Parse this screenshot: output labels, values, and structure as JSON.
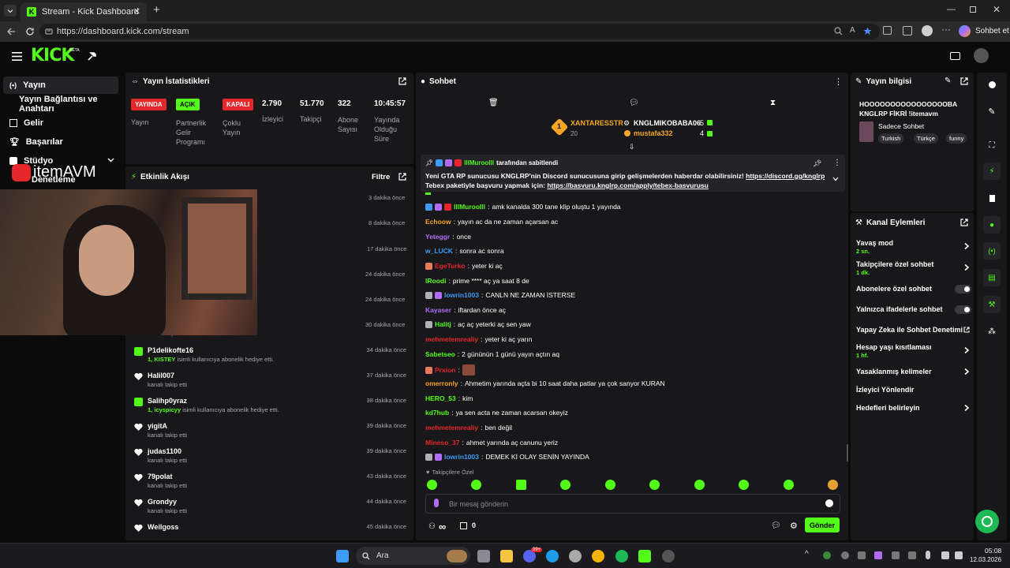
{
  "browser": {
    "tab_title": "Stream - Kick Dashboard",
    "url": "https://dashboard.kick.com/stream",
    "copilot_label": "Sohbet et"
  },
  "header": {
    "logo": "KICK",
    "beta": "BETA"
  },
  "sidebar": {
    "items": [
      {
        "label": "Yayın",
        "icon": "broadcast-icon"
      },
      {
        "label": "Yayın Bağlantısı ve Anahtarı",
        "icon": ""
      },
      {
        "label": "Gelir",
        "icon": "revenue-icon"
      },
      {
        "label": "Başarılar",
        "icon": "trophy-icon"
      },
      {
        "label": "Stüdyo",
        "icon": "studio-icon"
      },
      {
        "label": "Denetleme",
        "icon": "moderation-icon"
      }
    ]
  },
  "overlay": {
    "brand": "itemAVM"
  },
  "stats": {
    "title": "Yayın İstatistikleri",
    "items": [
      {
        "badge": "YAYINDA",
        "label": "Yayın",
        "badge_color": "#e5262a"
      },
      {
        "badge": "AÇIK",
        "label": "Partnerlik Gelir Programı",
        "badge_color": "#53fc18"
      },
      {
        "badge": "KAPALI",
        "label": "Çoklu Yayın",
        "badge_color": "#e5262a"
      },
      {
        "value": "2.790",
        "label": "İzleyici"
      },
      {
        "value": "51.770",
        "label": "Takipçi"
      },
      {
        "value": "322",
        "label": "Abone Sayısı"
      },
      {
        "value": "10:45:57",
        "label": "Yayında Olduğu Süre"
      }
    ]
  },
  "activity": {
    "title": "Etkinlik Akışı",
    "filter": "Filtre",
    "hidden_times": [
      "3 dakika önce",
      "8 dakika önce",
      "17 dakika önce",
      "24 dakika önce",
      "24 dakika önce",
      "30 dakika önce"
    ],
    "hidden_sub": "kanalı takip etti",
    "events": [
      {
        "name": "P1delikofte16",
        "sub_user": "1, KISTEY",
        "sub": " isimli kullanıcıya abonelik hediye etti.",
        "time": "34 dakika önce",
        "type": "gift"
      },
      {
        "name": "Halil007",
        "sub": "kanalı takip etti",
        "time": "37 dakika önce",
        "type": "follow"
      },
      {
        "name": "Salihp0yraz",
        "sub_user": "1, icyspicyy",
        "sub": " isimli kullanıcıya abonelik hediye etti.",
        "time": "38 dakika önce",
        "type": "gift"
      },
      {
        "name": "yigitA",
        "sub": "kanalı takip etti",
        "time": "39 dakika önce",
        "type": "follow"
      },
      {
        "name": "judas1100",
        "sub": "kanalı takip etti",
        "time": "39 dakika önce",
        "type": "follow"
      },
      {
        "name": "79polat",
        "sub": "kanalı takip etti",
        "time": "43 dakika önce",
        "type": "follow"
      },
      {
        "name": "Grondyy",
        "sub": "kanalı takip etti",
        "time": "44 dakika önce",
        "type": "follow"
      },
      {
        "name": "Weilgoss",
        "sub": "",
        "time": "45 dakika önce",
        "type": "follow"
      }
    ]
  },
  "chat": {
    "title": "Sohbet",
    "leaderboard": [
      {
        "rank": "1",
        "name": "XANTARESSTR",
        "count": "20"
      },
      {
        "name": "KNGLMIKOBABA06",
        "count": "5"
      },
      {
        "name": "mustafa332",
        "count": "4"
      }
    ],
    "pinned": {
      "by": "lllMurooIll",
      "by_suffix": "tarafından sabitlendi",
      "text": "Yeni GTA RP sunucusu KNGLRP'nin Discord sunucusuna girip gelişmelerden haberdar olabilirsiniz!",
      "link1": "https://discord.gg/knglrp",
      "text2": "Tebex paketiyle başvuru yapmak için:",
      "link2": "https://basvuru.knglrp.com/apply/tebex-basvurusu"
    },
    "messages": [
      {
        "user": "lllMurooIll",
        "color": "#53fc18",
        "text": "amk kanalda 300 tane klip oluştu 1 yayında",
        "badges": 3
      },
      {
        "user": "Echoow",
        "color": "#f5a623",
        "text": "yayın ac da ne zaman açarsan ac",
        "badges": 0
      },
      {
        "user": "Yeteggr",
        "color": "#b06cf5",
        "text": "once",
        "badges": 0
      },
      {
        "user": "w_LUCK",
        "color": "#3d9bf7",
        "text": "sonra ac sonra",
        "badges": 0
      },
      {
        "user": "EgeTurko",
        "color": "#e5262a",
        "text": "yeter ki aç",
        "badges": 1
      },
      {
        "user": "lRoodi",
        "color": "#53fc18",
        "text": "prime **** aç ya saat 8 de",
        "badges": 0
      },
      {
        "user": "lowrin1003",
        "color": "#3d9bf7",
        "text": "CANLN NE ZAMAN İSTERSE",
        "badges": 2
      },
      {
        "user": "Kayaser",
        "color": "#b06cf5",
        "text": "iftardan önce aç",
        "badges": 0
      },
      {
        "user": "Halitj",
        "color": "#53fc18",
        "text": "aç aç yeterki aç sen yaw",
        "badges": 1
      },
      {
        "user": "mehmetemrealiy",
        "color": "#e5262a",
        "text": "yeter ki aç yarın",
        "badges": 0
      },
      {
        "user": "Sabetseo",
        "color": "#53fc18",
        "text": "2 gününün 1 günü yayın açtın aq",
        "badges": 0
      },
      {
        "user": "Prxion",
        "color": "#e5262a",
        "text": "",
        "badges": 1
      },
      {
        "user": "omerronly",
        "color": "#f5a623",
        "text": "Ahmetim yarında açta bi 10 saat daha patlar ya çok sanyor KURAN",
        "badges": 0
      },
      {
        "user": "HERO_53",
        "color": "#53fc18",
        "text": "kim",
        "badges": 0
      },
      {
        "user": "kd7hub",
        "color": "#53fc18",
        "text": "ya sen acta ne zaman acarsan okeyiz",
        "badges": 0
      },
      {
        "user": "mehmetemrealiy",
        "color": "#e5262a",
        "text": "ben değil",
        "badges": 0
      },
      {
        "user": "Mineso_37",
        "color": "#e5262a",
        "text": "ahmet yarında aç canunu yeriz",
        "badges": 0
      },
      {
        "user": "lowrin1003",
        "color": "#3d9bf7",
        "text": "DEMEK Kİ OLAY SENİN YAYINDA",
        "badges": 2
      }
    ],
    "mode_label": "Takipçilere Özel",
    "input_placeholder": "Bir mesaj gönderin",
    "infinity": "∞",
    "gift_count": "0",
    "send": "Gönder"
  },
  "stream_info": {
    "title": "Yayın bilgisi",
    "stream_title": "HOOOOOOOOOOOOOOOOBA KNGLRP FİKRİ !itemavm",
    "category": "Sadece Sohbet",
    "tags": [
      "Turkish",
      "Türkçe",
      "funny"
    ]
  },
  "channel_actions": {
    "title": "Kanal Eylemleri",
    "items": [
      {
        "label": "Yavaş mod",
        "sub": "2 sn.",
        "control": "chevron"
      },
      {
        "label": "Takipçilere özel sohbet",
        "sub": "1 dk.",
        "control": "chevron"
      },
      {
        "label": "Abonelere özel sohbet",
        "sub": "",
        "control": "toggle"
      },
      {
        "label": "Yalnızca ifadelerle sohbet",
        "sub": "",
        "control": "toggle"
      },
      {
        "label": "Yapay Zeka ile Sohbet Denetimi",
        "sub": "",
        "control": "external"
      },
      {
        "label": "Hesap yaşı kısıtlaması",
        "sub": "1 hf.",
        "control": "chevron"
      },
      {
        "label": "Yasaklanmış kelimeler",
        "sub": "",
        "control": "chevron"
      },
      {
        "label": "İzleyici Yönlendir",
        "sub": "",
        "control": "none"
      },
      {
        "label": "Hedefleri belirleyin",
        "sub": "",
        "control": "chevron"
      }
    ]
  },
  "taskbar": {
    "search": "Ara",
    "time": "05:08",
    "date": "12.03.2026",
    "badge": "99+"
  },
  "colors": {
    "accent": "#53fc18",
    "panel": "#18181b",
    "live": "#e5262a"
  }
}
